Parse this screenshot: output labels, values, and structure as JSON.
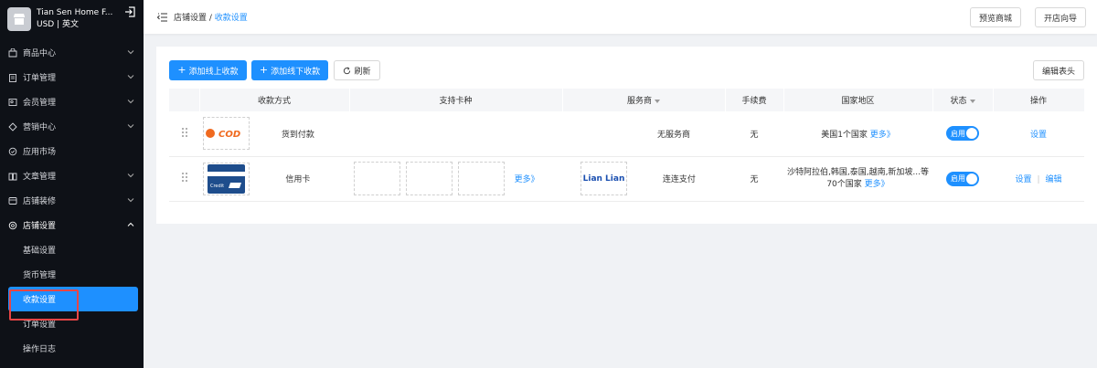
{
  "store": {
    "name": "Tian Sen Home F...",
    "sub": "USD | 英文"
  },
  "sidebar": {
    "items": [
      {
        "label": "商品中心",
        "icon": "bag-icon"
      },
      {
        "label": "订单管理",
        "icon": "clipboard-icon"
      },
      {
        "label": "会员管理",
        "icon": "member-icon"
      },
      {
        "label": "营销中心",
        "icon": "marketing-icon"
      },
      {
        "label": "应用市场",
        "icon": "apps-icon"
      },
      {
        "label": "文章管理",
        "icon": "book-icon"
      },
      {
        "label": "店铺装修",
        "icon": "decorate-icon"
      },
      {
        "label": "店铺设置",
        "icon": "settings-icon"
      }
    ],
    "subitems": [
      "基础设置",
      "货币管理",
      "收款设置",
      "订单设置",
      "操作日志"
    ]
  },
  "breadcrumb": {
    "parent": "店铺设置",
    "separator": " / ",
    "current": "收款设置"
  },
  "topbar": {
    "preview_label": "预览商城",
    "guide_label": "开店向导"
  },
  "toolbar": {
    "add_online_label": "添加线上收款",
    "add_offline_label": "添加线下收款",
    "refresh_label": "刷新",
    "edit_header_label": "编辑表头"
  },
  "table": {
    "headers": [
      "收款方式",
      "支持卡种",
      "服务商",
      "手续费",
      "国家地区",
      "状态",
      "操作"
    ],
    "rows": [
      {
        "logo": "COD",
        "method": "货到付款",
        "provider": "无服务商",
        "fee": "无",
        "region": "美国1个国家",
        "region_more": "更多》",
        "status": "启用",
        "action1": "设置"
      },
      {
        "logo": "Credit",
        "method": "信用卡",
        "cards_more": "更多》",
        "provider_logo": "Lian Lian",
        "provider": "连连支付",
        "fee": "无",
        "region_line1": "沙特阿拉伯,韩国,泰国,越南,新加坡...等",
        "region_line2": "70个国家",
        "region_more": "更多》",
        "status": "启用",
        "action1": "设置",
        "action_sep": "|",
        "action2": "编辑"
      }
    ]
  },
  "colors": {
    "accent": "#1e90ff",
    "sidebar_bg": "#0e1117",
    "cod_orange": "#f06a1f",
    "highlight": "#e84545"
  }
}
